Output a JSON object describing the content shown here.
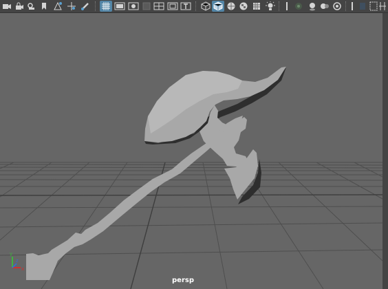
{
  "toolbar": {
    "icons": [
      "camera-select-icon",
      "lock-camera-icon",
      "camera-attributes-icon",
      "bookmark-icon",
      "image-plane-icon",
      "2d-pan-zoom-icon",
      "grease-pencil-icon",
      "grid-icon",
      "film-gate-icon",
      "resolution-gate-icon",
      "gate-mask-icon",
      "field-chart-icon",
      "safe-action-icon",
      "safe-title-icon",
      "wireframe-icon",
      "smooth-shade-icon",
      "wireframe-on-shaded-icon",
      "textured-icon",
      "use-all-lights-icon",
      "shadows-icon",
      "screen-space-ao-icon",
      "motion-blur-icon",
      "anti-aliasing-icon",
      "depth-of-field-icon",
      "isolate-select-icon",
      "xray-icon",
      "xray-joints-icon",
      "xray-active-components-icon",
      "camera-frame-icon"
    ],
    "active_icons": [
      "grid-icon",
      "smooth-shade-icon"
    ]
  },
  "viewport": {
    "camera_name": "persp",
    "background_color": "#666666",
    "grid_color": "#4e4e4e",
    "model_color": "#a6a6a6",
    "axis": {
      "x": "x",
      "y": "y",
      "z": "z"
    }
  }
}
